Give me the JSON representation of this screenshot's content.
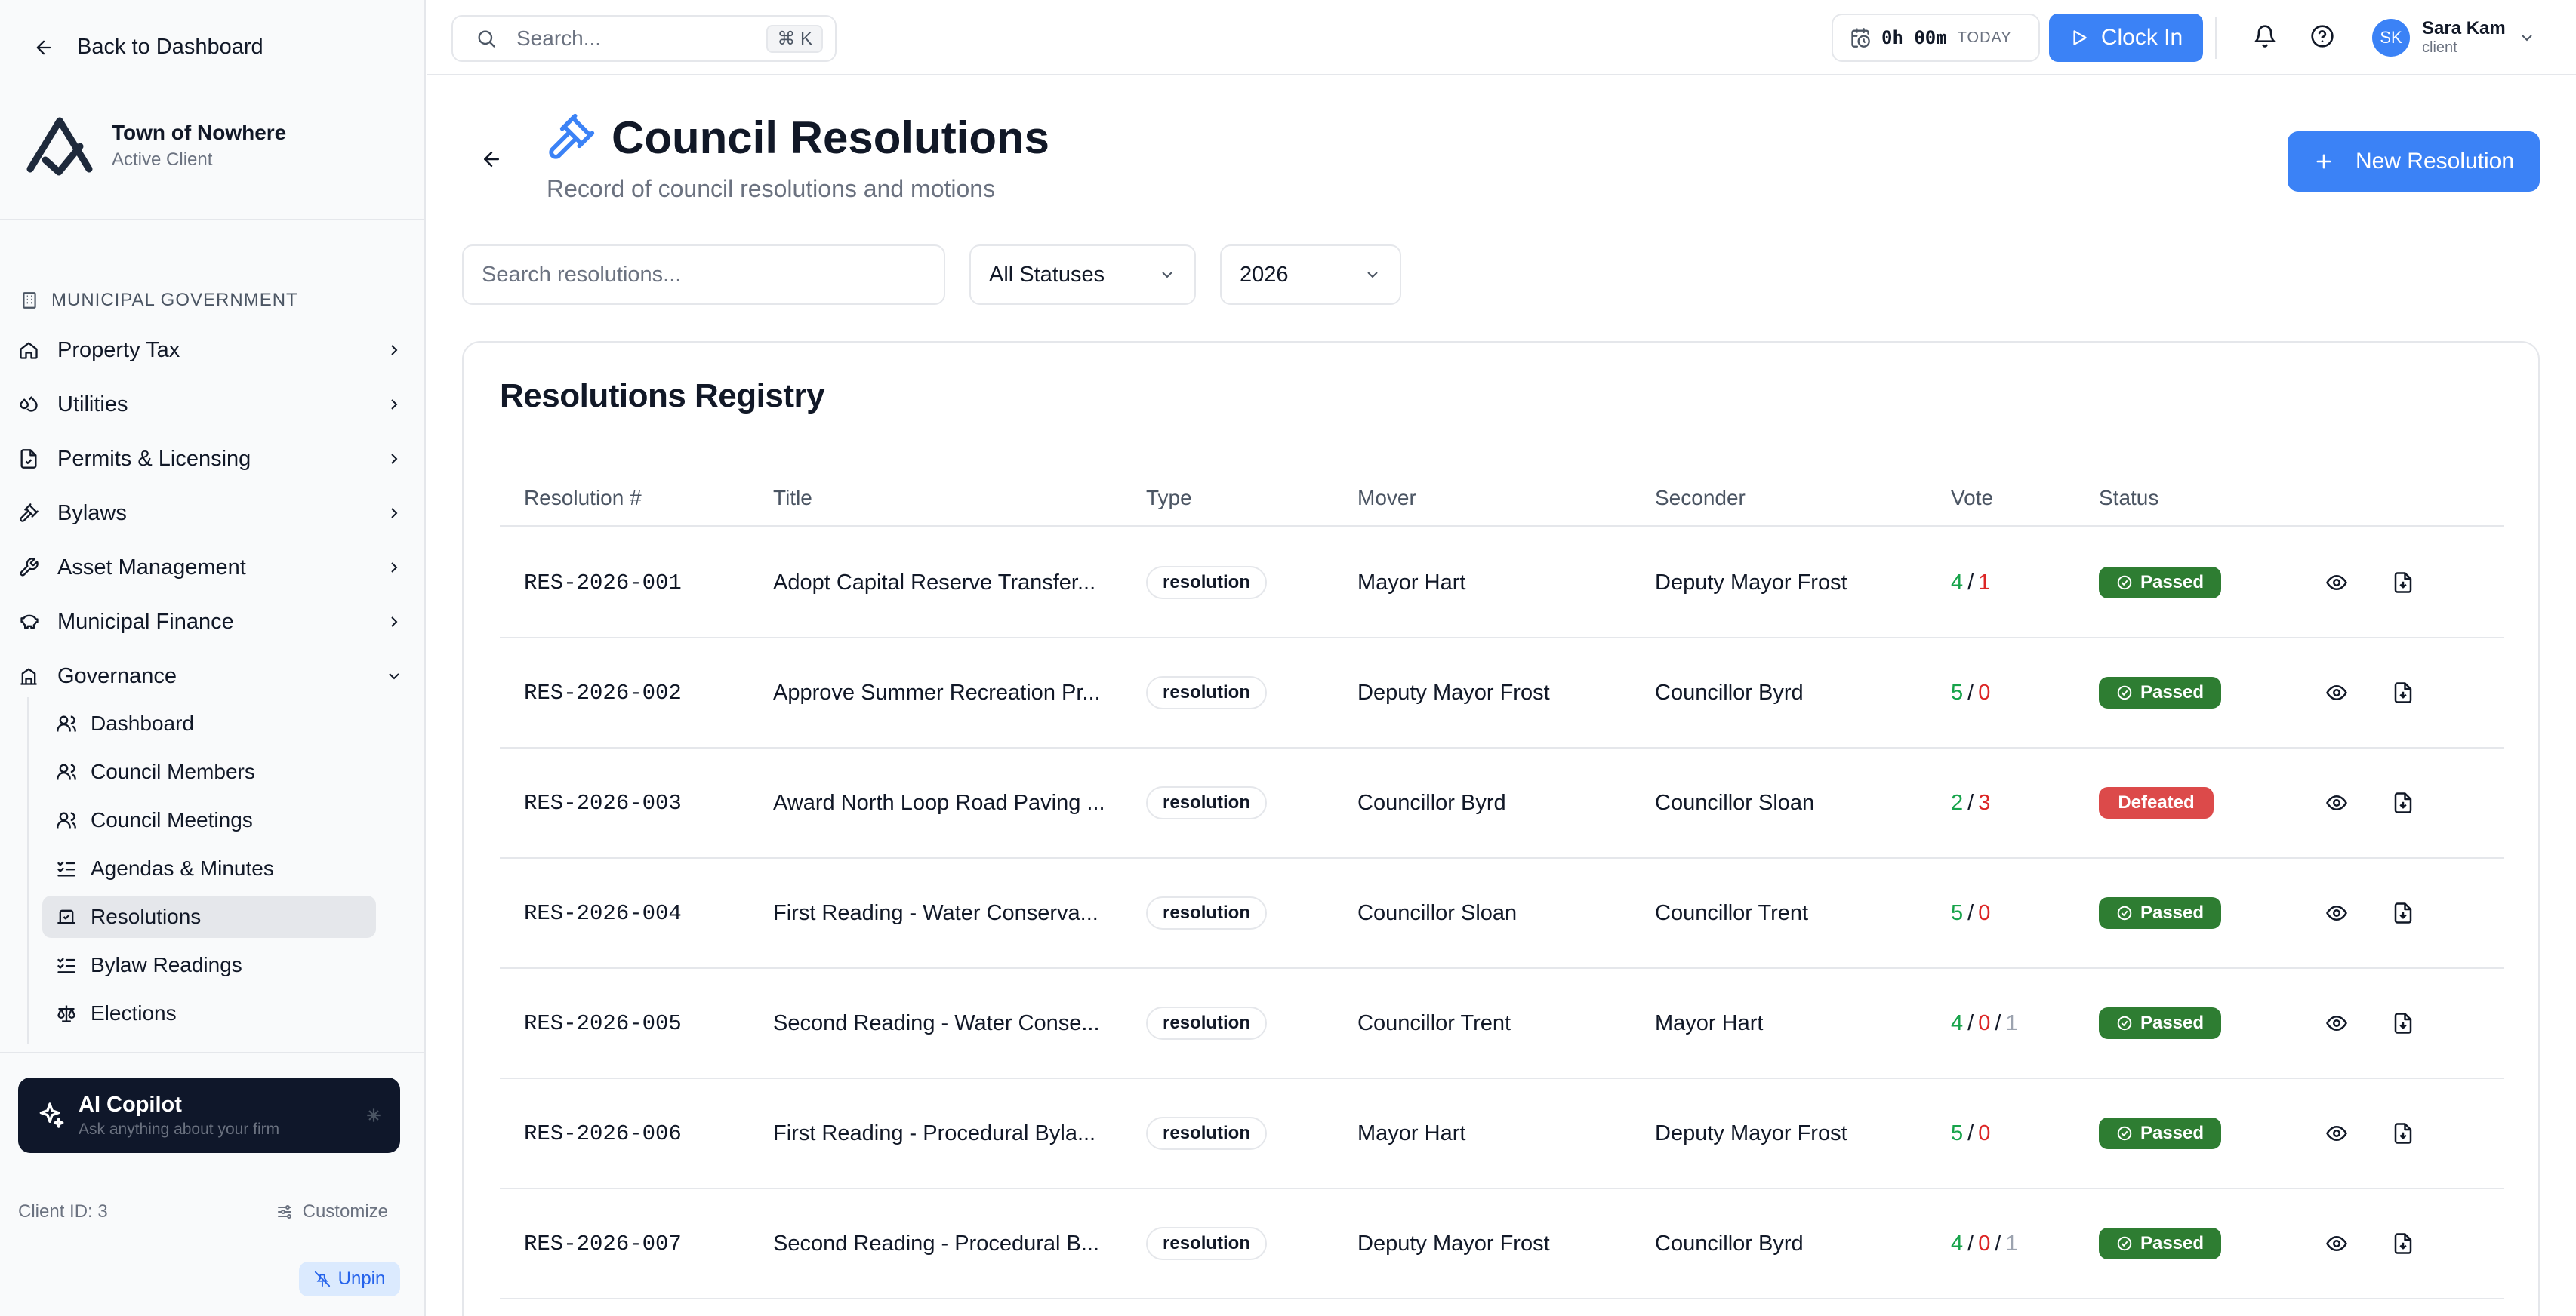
{
  "sidebar": {
    "back_label": "Back to Dashboard",
    "client_name": "Town of Nowhere",
    "client_status": "Active Client",
    "section_label": "MUNICIPAL GOVERNMENT",
    "nav": [
      {
        "label": "Property Tax",
        "icon": "home-icon"
      },
      {
        "label": "Utilities",
        "icon": "droplets-icon"
      },
      {
        "label": "Permits & Licensing",
        "icon": "file-icon"
      },
      {
        "label": "Bylaws",
        "icon": "gavel-icon"
      },
      {
        "label": "Asset Management",
        "icon": "wrench-icon"
      },
      {
        "label": "Municipal Finance",
        "icon": "piggy-bank-icon"
      },
      {
        "label": "Governance",
        "icon": "landmark-icon"
      }
    ],
    "sub_nav": [
      {
        "label": "Dashboard",
        "icon": "users-icon"
      },
      {
        "label": "Council Members",
        "icon": "users-icon"
      },
      {
        "label": "Council Meetings",
        "icon": "users-icon"
      },
      {
        "label": "Agendas & Minutes",
        "icon": "list-checks-icon"
      },
      {
        "label": "Resolutions",
        "icon": "vote-icon"
      },
      {
        "label": "Bylaw Readings",
        "icon": "list-checks-icon"
      },
      {
        "label": "Elections",
        "icon": "scale-icon"
      }
    ],
    "copilot_title": "AI Copilot",
    "copilot_subtitle": "Ask anything about your firm",
    "client_id": "Client ID: 3",
    "customize_label": "Customize",
    "unpin_label": "Unpin"
  },
  "topbar": {
    "search_placeholder": "Search...",
    "shortcut_symbol": "⌘",
    "shortcut_key": "K",
    "timer_value": "0h 00m",
    "timer_label": "TODAY",
    "clock_in_label": "Clock In",
    "user_initials": "SK",
    "user_name": "Sara Kam",
    "user_role": "client"
  },
  "page": {
    "title": "Council Resolutions",
    "subtitle": "Record of council resolutions and motions",
    "new_button": "New Resolution"
  },
  "filters": {
    "search_placeholder": "Search resolutions...",
    "status_value": "All Statuses",
    "year_value": "2026"
  },
  "table": {
    "title": "Resolutions Registry",
    "columns": [
      "Resolution #",
      "Title",
      "Type",
      "Mover",
      "Seconder",
      "Vote",
      "Status"
    ],
    "rows": [
      {
        "num": "RES-2026-001",
        "title": "Adopt Capital Reserve Transfer...",
        "type": "resolution",
        "mover": "Mayor Hart",
        "seconder": "Deputy Mayor Frost",
        "yes": "4",
        "no": "1",
        "abstain": "",
        "status": "Passed"
      },
      {
        "num": "RES-2026-002",
        "title": "Approve Summer Recreation Pr...",
        "type": "resolution",
        "mover": "Deputy Mayor Frost",
        "seconder": "Councillor Byrd",
        "yes": "5",
        "no": "0",
        "abstain": "",
        "status": "Passed"
      },
      {
        "num": "RES-2026-003",
        "title": "Award North Loop Road Paving ...",
        "type": "resolution",
        "mover": "Councillor Byrd",
        "seconder": "Councillor Sloan",
        "yes": "2",
        "no": "3",
        "abstain": "",
        "status": "Defeated"
      },
      {
        "num": "RES-2026-004",
        "title": "First Reading - Water Conserva...",
        "type": "resolution",
        "mover": "Councillor Sloan",
        "seconder": "Councillor Trent",
        "yes": "5",
        "no": "0",
        "abstain": "",
        "status": "Passed"
      },
      {
        "num": "RES-2026-005",
        "title": "Second Reading - Water Conse...",
        "type": "resolution",
        "mover": "Councillor Trent",
        "seconder": "Mayor Hart",
        "yes": "4",
        "no": "0",
        "abstain": "1",
        "status": "Passed"
      },
      {
        "num": "RES-2026-006",
        "title": "First Reading - Procedural Byla...",
        "type": "resolution",
        "mover": "Mayor Hart",
        "seconder": "Deputy Mayor Frost",
        "yes": "5",
        "no": "0",
        "abstain": "",
        "status": "Passed"
      },
      {
        "num": "RES-2026-007",
        "title": "Second Reading - Procedural B...",
        "type": "resolution",
        "mover": "Deputy Mayor Frost",
        "seconder": "Councillor Byrd",
        "yes": "4",
        "no": "0",
        "abstain": "1",
        "status": "Passed"
      }
    ]
  },
  "colors": {
    "accent": "#3b82f6",
    "passed": "#2e7d32",
    "defeated": "#dc4a4a",
    "vote_yes": "#16a34a",
    "vote_no": "#dc2626"
  }
}
